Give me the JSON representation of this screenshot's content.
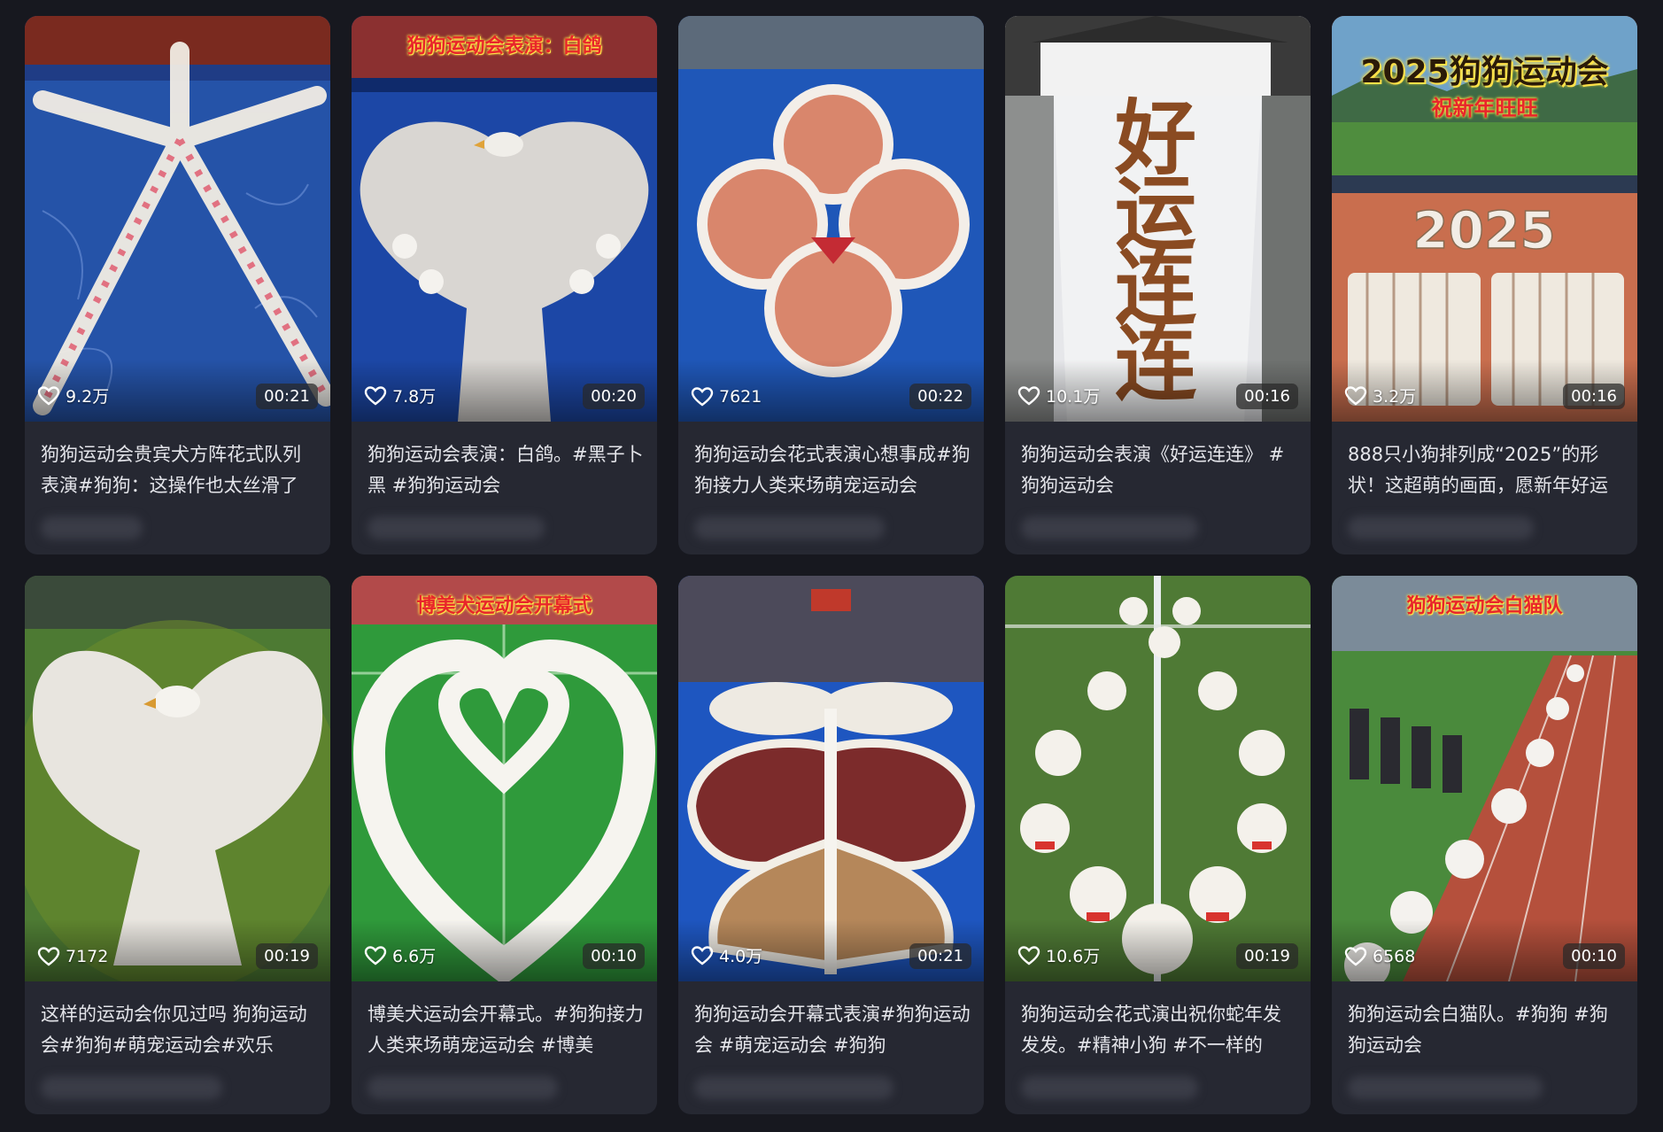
{
  "videos": [
    {
      "likes": "9.2万",
      "duration": "00:21",
      "description": "狗狗运动会贵宾犬方阵花式队列表演#狗狗：这操作也太丝滑了",
      "overlay_title": "",
      "overlay_subtitle": ""
    },
    {
      "likes": "7.8万",
      "duration": "00:20",
      "description": "狗狗运动会表演：白鸽。#黑子卜黑 #狗狗运动会",
      "overlay_title": "狗狗运动会表演：白鸽",
      "overlay_subtitle": ""
    },
    {
      "likes": "7621",
      "duration": "00:22",
      "description": "狗狗运动会花式表演心想事成#狗狗接力人类来场萌宠运动会",
      "overlay_title": "",
      "overlay_subtitle": ""
    },
    {
      "likes": "10.1万",
      "duration": "00:16",
      "description": "狗狗运动会表演《好运连连》 #狗狗运动会",
      "overlay_title": "",
      "overlay_subtitle": ""
    },
    {
      "likes": "3.2万",
      "duration": "00:16",
      "description": "888只小狗排列成“2025”的形状！这超萌的画面，愿新年好运",
      "overlay_title": "2025狗狗运动会",
      "overlay_subtitle": "祝新年旺旺"
    },
    {
      "likes": "7172",
      "duration": "00:19",
      "description": "这样的运动会你见过吗 狗狗运动会#狗狗#萌宠运动会#欢乐",
      "overlay_title": "",
      "overlay_subtitle": ""
    },
    {
      "likes": "6.6万",
      "duration": "00:10",
      "description": "博美犬运动会开幕式。#狗狗接力人类来场萌宠运动会 #博美",
      "overlay_title": "博美犬运动会开幕式",
      "overlay_subtitle": ""
    },
    {
      "likes": "4.0万",
      "duration": "00:21",
      "description": "狗狗运动会开幕式表演#狗狗运动会 #萌宠运动会 #狗狗",
      "overlay_title": "",
      "overlay_subtitle": ""
    },
    {
      "likes": "10.6万",
      "duration": "00:19",
      "description": "狗狗运动会花式演出祝你蛇年发发发。#精神小狗 #不一样的",
      "overlay_title": "",
      "overlay_subtitle": ""
    },
    {
      "likes": "6568",
      "duration": "00:10",
      "description": "狗狗运动会白猫队。#狗狗 #狗狗运动会",
      "overlay_title": "狗狗运动会白猫队",
      "overlay_subtitle": ""
    }
  ],
  "thumbnail_text": {
    "video_4_characters": [
      "好",
      "运",
      "连",
      "连"
    ],
    "video_5_year": "2025"
  },
  "icons": {
    "like": "heart-outline-icon"
  },
  "colors": {
    "page_bg": "#17181f",
    "card_bg": "#262832",
    "text": "#e4e5ea",
    "overlay_red": "#e8262b",
    "overlay_yellow": "#ffe24a"
  }
}
